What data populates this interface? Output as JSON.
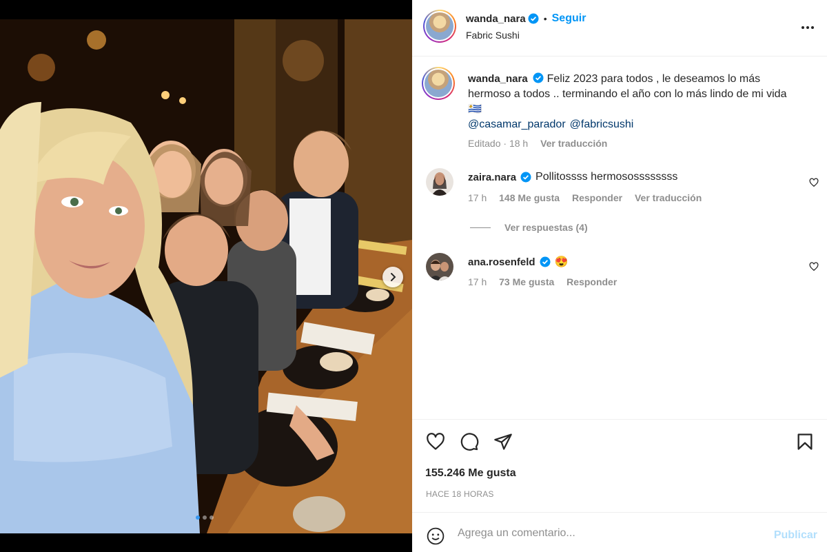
{
  "post": {
    "author": "wanda_nara",
    "follow_label": "Seguir",
    "separator": "•",
    "location": "Fabric Sushi",
    "caption": "Feliz 2023 para todos , le deseamos lo más hermoso a todos .. terminando el año con lo más lindo de mi vida 🇺🇾",
    "mentions": [
      "@casamar_parador",
      "@fabricsushi"
    ],
    "caption_edited": "Editado",
    "caption_dot": "·",
    "caption_time": "18 h",
    "caption_translate": "Ver traducción",
    "carousel": {
      "total": 3,
      "active": 0
    }
  },
  "comments": [
    {
      "username": "zaira.nara",
      "text": "Pollitossss hermosossssssss",
      "time": "17 h",
      "likes": "148 Me gusta",
      "reply_label": "Responder",
      "translate_label": "Ver traducción",
      "view_replies": "Ver respuestas (4)"
    },
    {
      "username": "ana.rosenfeld",
      "text": "😍",
      "time": "17 h",
      "likes": "73 Me gusta",
      "reply_label": "Responder"
    }
  ],
  "stats": {
    "likes": "155.246 Me gusta",
    "posted_ago": "HACE 18 HORAS"
  },
  "composer": {
    "placeholder": "Agrega un comentario...",
    "publish_label": "Publicar"
  },
  "icons": {
    "like": "heart-icon",
    "comment": "comment-icon",
    "share": "share-icon",
    "save": "bookmark-icon",
    "more": "more-icon",
    "emoji": "emoji-icon",
    "verified": "verified-badge-icon",
    "next": "chevron-right-icon"
  },
  "colors": {
    "accent": "#0095f6",
    "verified": "#0095f6",
    "publish_disabled": "#b2dffc",
    "muted": "#8e8e8e"
  }
}
